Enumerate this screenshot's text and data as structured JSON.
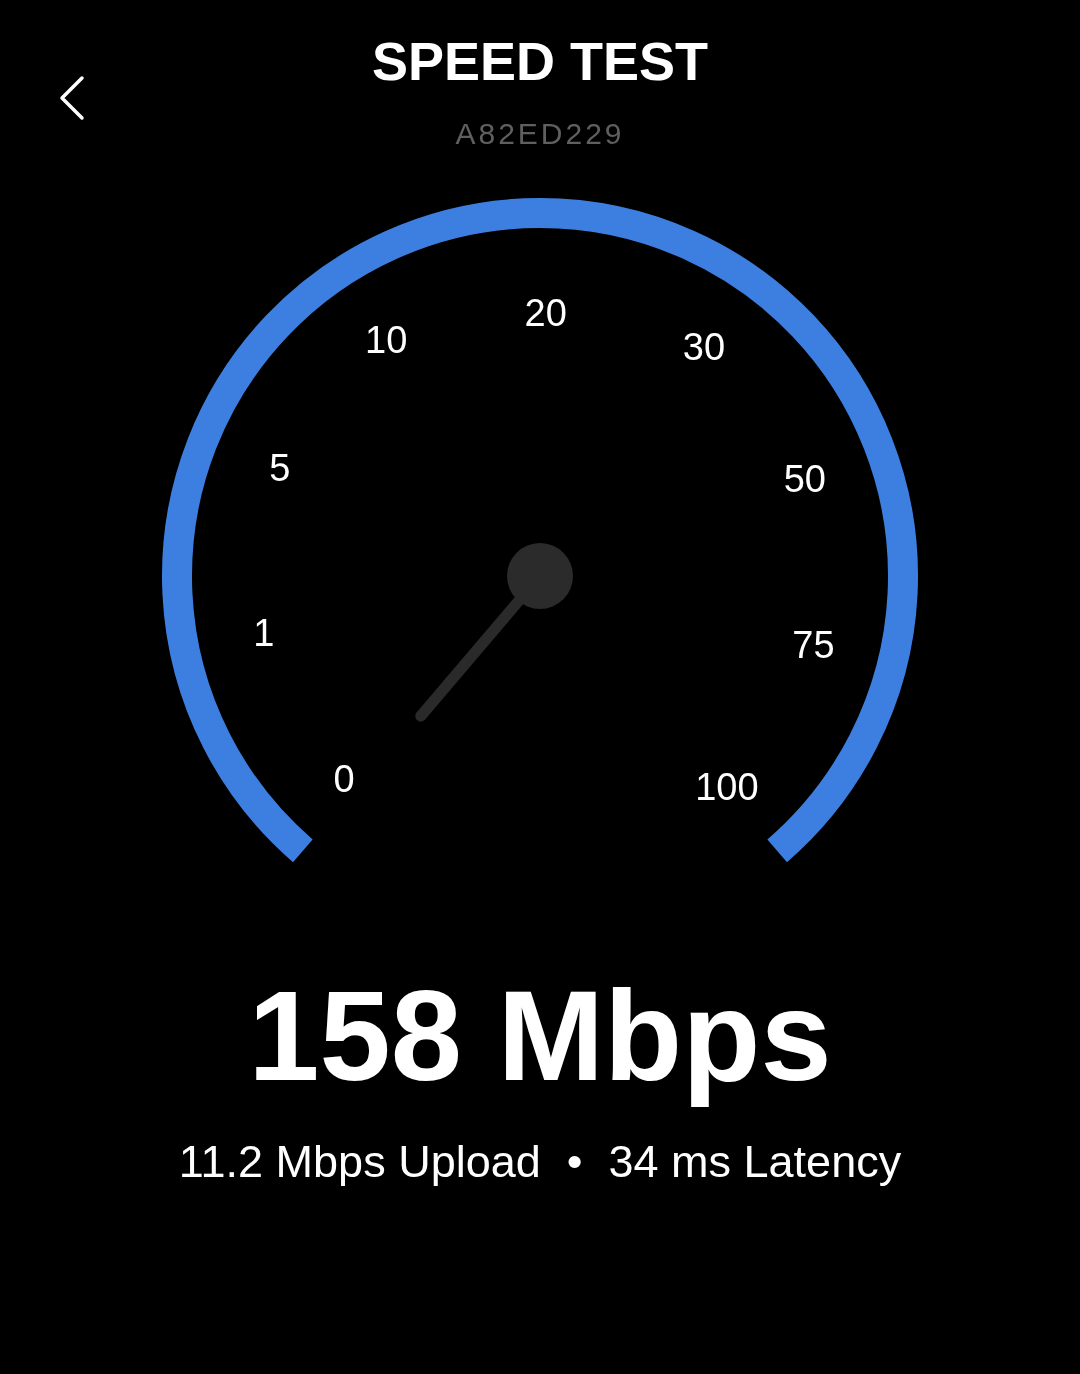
{
  "header": {
    "title": "SPEED TEST",
    "subtitle": "A82ED229"
  },
  "gauge": {
    "scale_labels": [
      "0",
      "1",
      "5",
      "10",
      "20",
      "30",
      "50",
      "75",
      "100"
    ]
  },
  "result": {
    "download": "158 Mbps",
    "upload": "11.2 Mbps Upload",
    "separator": "•",
    "latency": "34 ms Latency"
  }
}
